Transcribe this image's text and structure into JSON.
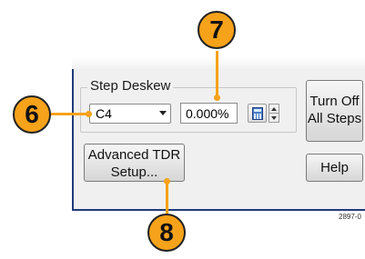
{
  "group": {
    "label": "Step Deskew"
  },
  "channel_select": {
    "value": "C4"
  },
  "deskew_field": {
    "value": "0.000%"
  },
  "buttons": {
    "turn_off_line1": "Turn Off",
    "turn_off_line2": "All Steps",
    "help": "Help",
    "advanced_line1": "Advanced TDR",
    "advanced_line2": "Setup..."
  },
  "callouts": {
    "six": "6",
    "seven": "7",
    "eight": "8"
  },
  "figure_id": "2897-0",
  "colors": {
    "callout": "#f6a21a",
    "panel_border": "#1f3b7a"
  }
}
